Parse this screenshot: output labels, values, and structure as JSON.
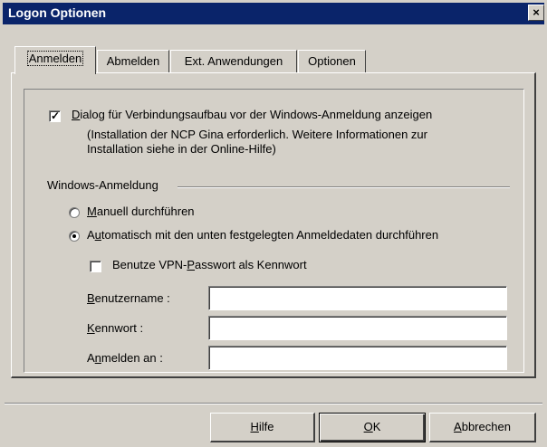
{
  "window": {
    "title": "Logon Optionen",
    "close_label": "×"
  },
  "tabs": [
    {
      "label": "Anmelden",
      "active": true
    },
    {
      "label": "Abmelden",
      "active": false
    },
    {
      "label": "Ext. Anwendungen",
      "active": false
    },
    {
      "label": "Optionen",
      "active": false
    }
  ],
  "dialog_checkbox": {
    "checked": true,
    "mnemonic": "D",
    "label_rest": "ialog für Verbindungsaufbau vor der Windows-Anmeldung anzeigen",
    "note_line1": "(Installation der NCP Gina erforderlich. Weitere Informationen zur",
    "note_line2": "Installation siehe in der Online-Hilfe)"
  },
  "windows_logon": {
    "group_label": "Windows-Anmeldung",
    "radio_manual": {
      "mnemonic": "M",
      "label_rest": "anuell durchführen",
      "selected": false
    },
    "radio_auto": {
      "prefix": "A",
      "mnemonic": "u",
      "label_rest": "tomatisch mit den unten festgelegten Anmeldedaten durchführen",
      "selected": true
    },
    "vpn_password": {
      "prefix": "Benutze VPN-",
      "mnemonic": "P",
      "label_rest": "asswort als Kennwort",
      "checked": false
    },
    "fields": [
      {
        "prefix": "",
        "mnemonic": "B",
        "label_rest": "enutzername :",
        "value": ""
      },
      {
        "prefix": "",
        "mnemonic": "K",
        "label_rest": "ennwort :",
        "value": ""
      },
      {
        "prefix": "A",
        "mnemonic": "n",
        "label_rest": "melden an :",
        "value": ""
      }
    ]
  },
  "buttons": {
    "help": {
      "mnemonic": "H",
      "label_rest": "ilfe"
    },
    "ok": {
      "mnemonic": "O",
      "label_rest": "K"
    },
    "cancel": {
      "mnemonic": "A",
      "label_rest": "bbrechen"
    }
  }
}
